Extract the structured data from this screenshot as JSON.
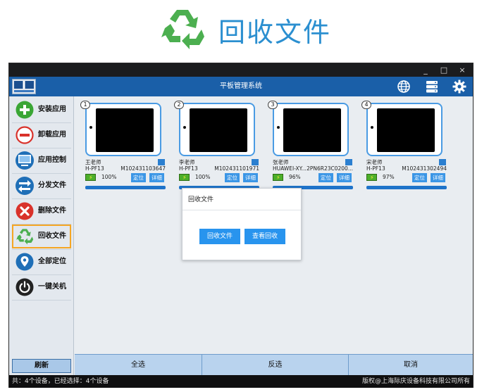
{
  "banner": {
    "title": "回收文件",
    "icon": "recycle-icon",
    "icon_color": "#4caf50"
  },
  "window": {
    "controls": [
      "_",
      "□",
      "×"
    ]
  },
  "header": {
    "title": "平板管理系统",
    "icons": [
      "globe-icon",
      "server-icon",
      "gear-icon"
    ],
    "bg_color": "#1a5fa8"
  },
  "sidebar": {
    "items": [
      {
        "label": "安装应用",
        "icon": "plus-icon",
        "color": "#3aa635"
      },
      {
        "label": "卸载应用",
        "icon": "minus-icon",
        "color": "#d9322b"
      },
      {
        "label": "应用控制",
        "icon": "computer-icon",
        "color": "#1f6fb7"
      },
      {
        "label": "分发文件",
        "icon": "transfer-icon",
        "color": "#1f6fb7"
      },
      {
        "label": "删除文件",
        "icon": "delete-icon",
        "color": "#d9322b"
      },
      {
        "label": "回收文件",
        "icon": "recycle-icon",
        "color": "#4caf50",
        "active": true
      },
      {
        "label": "全部定位",
        "icon": "location-icon",
        "color": "#1f6fb7"
      },
      {
        "label": "一键关机",
        "icon": "power-icon",
        "color": "#222222"
      }
    ],
    "refresh_label": "刷新"
  },
  "devices": [
    {
      "num": "1",
      "name": "王老师",
      "model": "H-PF13",
      "serial": "M102431103647",
      "battery": "100%",
      "locate_label": "定位",
      "detail_label": "详细"
    },
    {
      "num": "2",
      "name": "李老师",
      "model": "H-PF13",
      "serial": "M102431101971",
      "battery": "100%",
      "locate_label": "定位",
      "detail_label": "详细"
    },
    {
      "num": "3",
      "name": "张老师",
      "model": "HUAWEI-XY...",
      "serial": "2PN6R23C0200...",
      "battery": "96%",
      "locate_label": "定位",
      "detail_label": "详细"
    },
    {
      "num": "4",
      "name": "宋老师",
      "model": "H-PF13",
      "serial": "M102431302494",
      "battery": "97%",
      "locate_label": "定位",
      "detail_label": "详细"
    }
  ],
  "bottom": {
    "select_all": "全选",
    "invert": "反选",
    "cancel": "取消"
  },
  "status": {
    "left": "共：4个设备，已经选择：4个设备",
    "right": "版权@上海际庆设备科技有限公司所有"
  },
  "modal": {
    "title": "回收文件",
    "recycle_label": "回收文件",
    "view_label": "查看回收",
    "button_color": "#2894ee"
  }
}
